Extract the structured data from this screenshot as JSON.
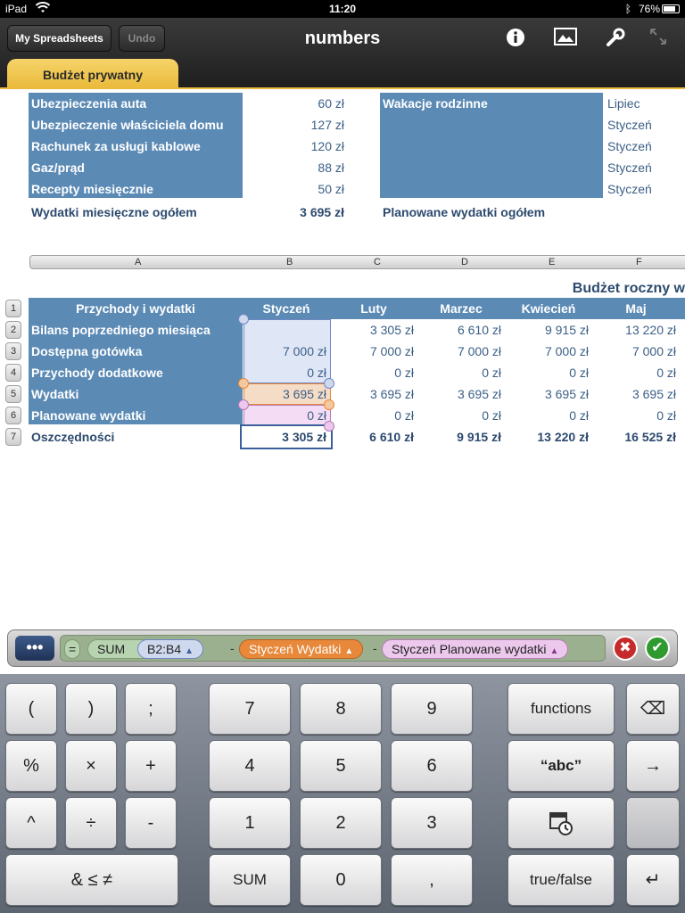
{
  "status_bar": {
    "device": "iPad",
    "time": "11:20",
    "battery": "76%"
  },
  "toolbar": {
    "my_spreadsheets": "My Spreadsheets",
    "undo": "Undo",
    "title": "numbers",
    "icons": [
      "info-icon",
      "image-icon",
      "wrench-icon",
      "fullscreen-icon"
    ]
  },
  "tab": {
    "label": "Budżet prywatny"
  },
  "top_table": {
    "rows": [
      {
        "label": "Ubezpieczenia auta",
        "value": "60 zł",
        "right_label": "Wakacje rodzinne",
        "right_value": "Lipiec"
      },
      {
        "label": "Ubezpieczenie właściciela domu",
        "value": "127 zł",
        "right_label": "",
        "right_value": "Styczeń"
      },
      {
        "label": "Rachunek za usługi kablowe",
        "value": "120 zł",
        "right_label": "",
        "right_value": "Styczeń"
      },
      {
        "label": "Gaz/prąd",
        "value": "88 zł",
        "right_label": "",
        "right_value": "Styczeń"
      },
      {
        "label": "Recepty miesięcznie",
        "value": "50 zł",
        "right_label": "",
        "right_value": "Styczeń"
      }
    ],
    "total_label": "Wydatki miesięczne ogółem",
    "total_value": "3 695 zł",
    "planned_label": "Planowane wydatki ogółem"
  },
  "col_letters": [
    "A",
    "B",
    "C",
    "D",
    "E",
    "F"
  ],
  "row_numbers": [
    "1",
    "2",
    "3",
    "4",
    "5",
    "6",
    "7"
  ],
  "annual_table": {
    "title": "Budżet roczny w",
    "header": [
      "Przychody i wydatki",
      "Styczeń",
      "Luty",
      "Marzec",
      "Kwiecień",
      "Maj"
    ],
    "rows": [
      {
        "label": "Bilans poprzedniego miesiąca",
        "values": [
          "",
          "3 305 zł",
          "6 610 zł",
          "9 915 zł",
          "13 220 zł"
        ]
      },
      {
        "label": "Dostępna gotówka",
        "values": [
          "7 000 zł",
          "7 000 zł",
          "7 000 zł",
          "7 000 zł",
          "7 000 zł"
        ]
      },
      {
        "label": "Przychody dodatkowe",
        "values": [
          "0 zł",
          "0 zł",
          "0 zł",
          "0 zł",
          "0 zł"
        ]
      },
      {
        "label": "Wydatki",
        "values": [
          "3 695 zł",
          "3 695 zł",
          "3 695 zł",
          "3 695 zł",
          "3 695 zł"
        ]
      },
      {
        "label": "Planowane wydatki",
        "values": [
          "0 zł",
          "0 zł",
          "0 zł",
          "0 zł",
          "0 zł"
        ]
      },
      {
        "label": "Oszczędności",
        "values": [
          "3 305 zł",
          "6 610 zł",
          "9 915 zł",
          "13 220 zł",
          "16 525 zł"
        ]
      }
    ]
  },
  "formula": {
    "equals": "=",
    "sum": "SUM",
    "range": "B2:B4",
    "minus1": "-",
    "ref1": "Styczeń Wydatki",
    "minus2": "-",
    "ref2": "Styczeń Planowane wydatki",
    "cancel": "✖",
    "accept": "✔"
  },
  "keyboard": {
    "k_lparen": "(",
    "k_rparen": ")",
    "k_semi": ";",
    "k_pct": "%",
    "k_times": "×",
    "k_plus": "+",
    "k_caret": "^",
    "k_div": "÷",
    "k_minus": "-",
    "k_logic": "& ≤ ≠",
    "k7": "7",
    "k8": "8",
    "k9": "9",
    "k4": "4",
    "k5": "5",
    "k6": "6",
    "k1": "1",
    "k2": "2",
    "k3": "3",
    "k_sum": "SUM",
    "k0": "0",
    "k_comma": ",",
    "k_functions": "functions",
    "k_abc": "“abc”",
    "k_truefalse": "true/false",
    "k_backspace": "⌫",
    "k_next": "→",
    "k_return": "↵"
  }
}
